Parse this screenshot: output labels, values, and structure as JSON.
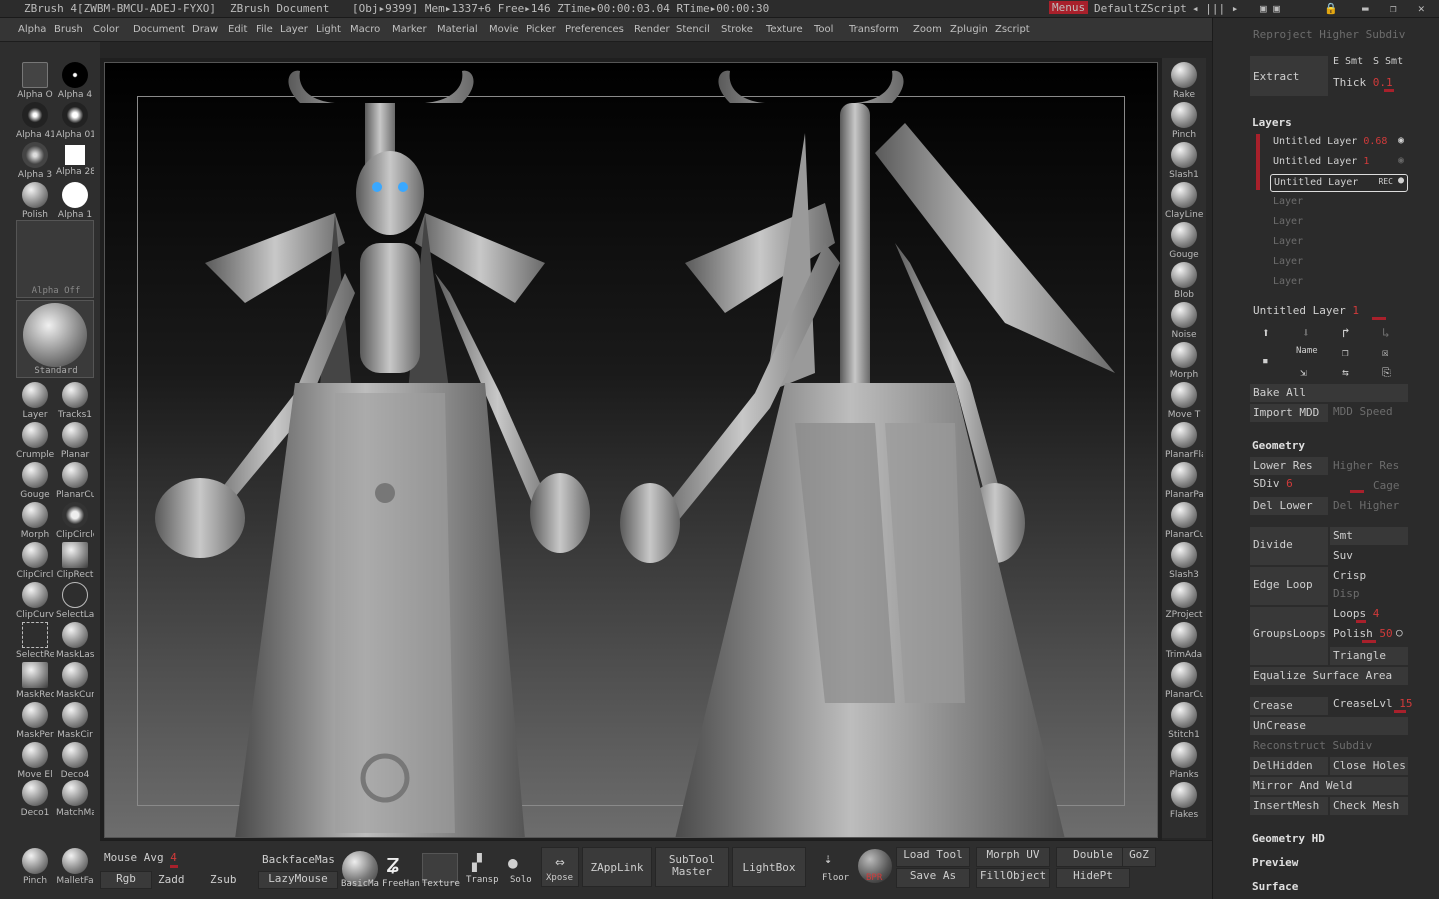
{
  "titlebar": {
    "app": "ZBrush 4[ZWBM-BMCU-ADEJ-FYXO]",
    "doc": "ZBrush Document",
    "stats": "[Obj▸9399] Mem▸1337+6  Free▸146  ZTime▸00:00:03.04  RTime▸00:00:30",
    "menus": "Menus",
    "script": "DefaultZScript"
  },
  "menubar": [
    "Alpha",
    "Brush",
    "Color",
    "Document",
    "Draw",
    "Edit",
    "File",
    "Layer",
    "Light",
    "Macro",
    "Marker",
    "Material",
    "Movie",
    "Picker",
    "Preferences",
    "Render",
    "Stencil",
    "Stroke",
    "Texture",
    "Tool",
    "Transform",
    "Zoom",
    "Zplugin",
    "Zscript"
  ],
  "left": {
    "alphas": [
      "Alpha O",
      "Alpha 4",
      "Alpha 41",
      "Alpha 01",
      "Alpha 3",
      "Alpha 28",
      "Polish",
      "Alpha 1"
    ],
    "alpha_off": "Alpha Off",
    "standard": "Standard",
    "brushes": [
      "Layer",
      "Tracks1",
      "Crumple",
      "Planar",
      "Gouge",
      "PlanarCu",
      "Morph",
      "ClipCircle",
      "ClipCircl",
      "ClipRect",
      "ClipCurv",
      "SelectLa",
      "SelectRe",
      "MaskLas",
      "MaskRec",
      "MaskCur",
      "MaskPer",
      "MaskCir",
      "Move El",
      "Deco4",
      "Deco1",
      "MatchMa",
      "Pinch",
      "MalletFa"
    ]
  },
  "rightshelf": [
    "Rake",
    "Pinch",
    "Slash1",
    "ClayLine",
    "Gouge",
    "Blob",
    "Noise",
    "Morph",
    "Move T",
    "PlanarFla",
    "PlanarPa",
    "PlanarCu",
    "Slash3",
    "ZProject",
    "TrimAda",
    "PlanarCu",
    "Stitch1",
    "Planks",
    "Flakes"
  ],
  "bottom": {
    "mouse_avg": "Mouse Avg",
    "mouse_avg_val": "4",
    "rgb": "Rgb",
    "zadd": "Zadd",
    "zsub": "Zsub",
    "backface": "BackfaceMas",
    "lazymouse": "LazyMouse",
    "basicmat": "BasicMa",
    "freehand": "FreeHan",
    "texture": "Texture",
    "transp": "Transp",
    "solo": "Solo",
    "xpose": "Xpose",
    "zapplink": "ZAppLink",
    "subtool": "SubTool Master",
    "lightbox": "LightBox",
    "floor": "Floor",
    "bpr": "BPR",
    "loadtool": "Load Tool",
    "saveas": "Save As",
    "morphuv": "Morph UV",
    "fillobject": "FillObject",
    "double": "Double",
    "hidept": "HidePt",
    "goz": "GoZ"
  },
  "panel": {
    "reproject": "Reproject Higher Subdiv",
    "extract": "Extract",
    "esmt": "E Smt",
    "ssmt": "S Smt",
    "thick": "Thick",
    "thick_val": "0.1",
    "layers": "Layers",
    "layer_rows": [
      {
        "name": "Untitled Layer",
        "val": "0.68"
      },
      {
        "name": "Untitled Layer",
        "val": "1"
      },
      {
        "name": "Untitled Layer",
        "val": "REC"
      }
    ],
    "empty_layers": [
      "Layer",
      "Layer",
      "Layer",
      "Layer",
      "Layer"
    ],
    "cur_layer": "Untitled Layer",
    "cur_layer_val": "1",
    "name": "Name",
    "bake_all": "Bake All",
    "import_mdd": "Import MDD",
    "mdd_speed": "MDD Speed",
    "geometry": "Geometry",
    "lower_res": "Lower Res",
    "higher_res": "Higher Res",
    "sdiv": "SDiv",
    "sdiv_val": "6",
    "cage": "Cage",
    "del_lower": "Del Lower",
    "del_higher": "Del Higher",
    "divide": "Divide",
    "smt": "Smt",
    "suv": "Suv",
    "edge_loop": "Edge Loop",
    "crisp": "Crisp",
    "disp": "Disp",
    "groups_loops": "GroupsLoops",
    "loops": "Loops",
    "loops_val": "4",
    "polish": "Polish",
    "polish_val": "50",
    "triangle": "Triangle",
    "equalize": "Equalize Surface Area",
    "crease": "Crease",
    "creaselvl": "CreaseLvl",
    "creaselvl_val": "15",
    "uncrease": "UnCrease",
    "reconstruct": "Reconstruct Subdiv",
    "delhidden": "DelHidden",
    "close_holes": "Close Holes",
    "mirror_weld": "Mirror And Weld",
    "insertmesh": "InsertMesh",
    "check_mesh": "Check Mesh",
    "geometry_hd": "Geometry HD",
    "preview": "Preview",
    "surface": "Surface"
  }
}
